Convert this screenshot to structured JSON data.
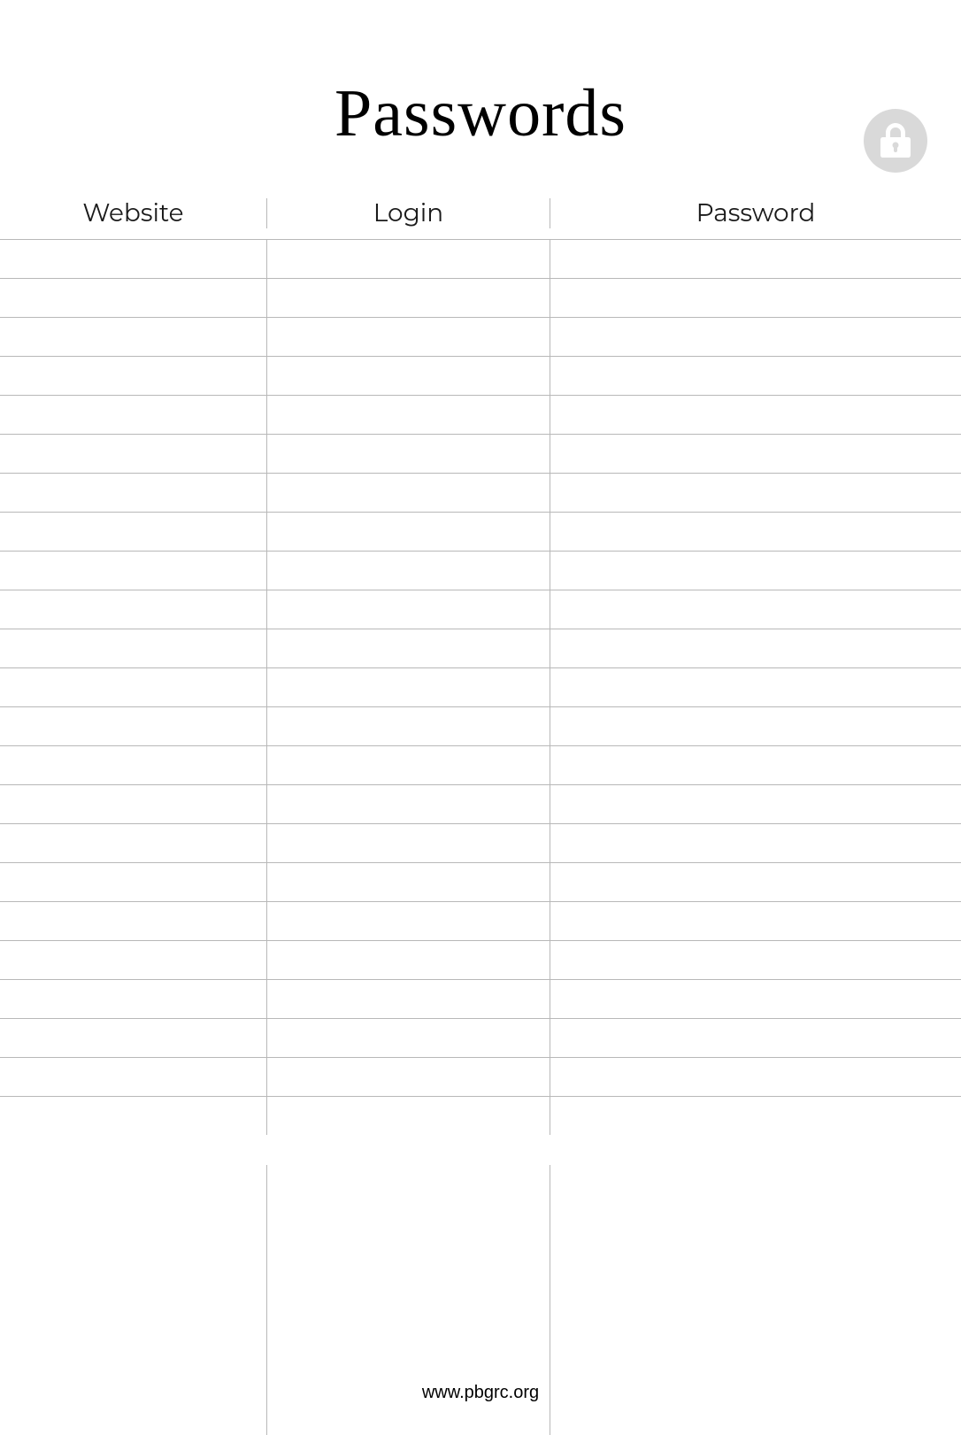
{
  "title": "Passwords",
  "columns": {
    "website": "Website",
    "login": "Login",
    "password": "Password"
  },
  "rows": [
    {
      "website": "",
      "login": "",
      "password": ""
    },
    {
      "website": "",
      "login": "",
      "password": ""
    },
    {
      "website": "",
      "login": "",
      "password": ""
    },
    {
      "website": "",
      "login": "",
      "password": ""
    },
    {
      "website": "",
      "login": "",
      "password": ""
    },
    {
      "website": "",
      "login": "",
      "password": ""
    },
    {
      "website": "",
      "login": "",
      "password": ""
    },
    {
      "website": "",
      "login": "",
      "password": ""
    },
    {
      "website": "",
      "login": "",
      "password": ""
    },
    {
      "website": "",
      "login": "",
      "password": ""
    },
    {
      "website": "",
      "login": "",
      "password": ""
    },
    {
      "website": "",
      "login": "",
      "password": ""
    },
    {
      "website": "",
      "login": "",
      "password": ""
    },
    {
      "website": "",
      "login": "",
      "password": ""
    },
    {
      "website": "",
      "login": "",
      "password": ""
    },
    {
      "website": "",
      "login": "",
      "password": ""
    },
    {
      "website": "",
      "login": "",
      "password": ""
    },
    {
      "website": "",
      "login": "",
      "password": ""
    },
    {
      "website": "",
      "login": "",
      "password": ""
    },
    {
      "website": "",
      "login": "",
      "password": ""
    },
    {
      "website": "",
      "login": "",
      "password": ""
    },
    {
      "website": "",
      "login": "",
      "password": ""
    },
    {
      "website": "",
      "login": "",
      "password": ""
    }
  ],
  "footer": "www.pbgrc.org"
}
